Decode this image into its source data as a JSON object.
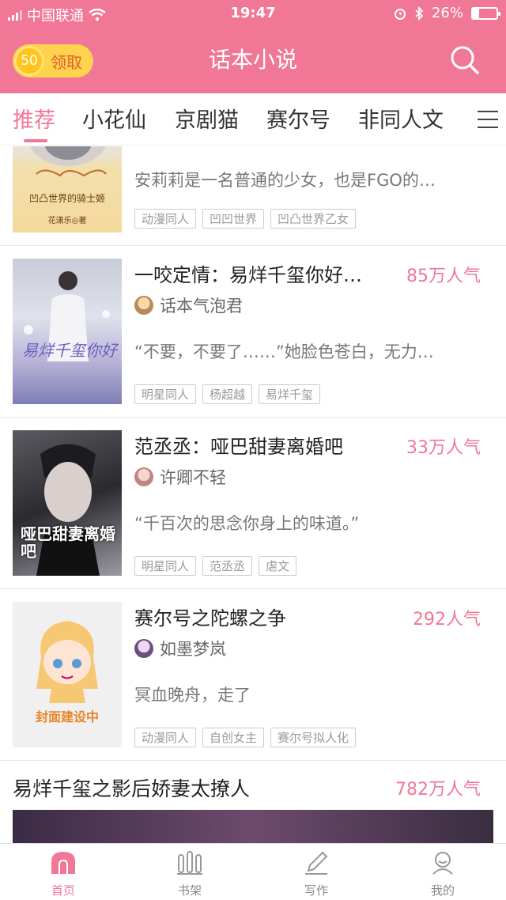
{
  "status_bar": {
    "carrier": "中国联通",
    "time": "19:47",
    "battery": "26%"
  },
  "header": {
    "coin_amount": "50",
    "claim_label": "领取",
    "title": "话本小说"
  },
  "tabs": [
    "推荐",
    "小花仙",
    "京剧猫",
    "赛尔号",
    "非同人文"
  ],
  "active_tab": 0,
  "books": [
    {
      "description": "安莉莉是一名普通的少女，也是FGO的…",
      "tags": [
        "动漫同人",
        "凹凹世界",
        "凹凸世界乙女"
      ],
      "cover_text": "凹凸世界的骑士姬",
      "cover_byline": "花潇乐◎著"
    },
    {
      "title": "一咬定情：易烊千玺你好…",
      "popularity": "85万人气",
      "author": "话本气泡君",
      "description": "“不要，不要了……”她脸色苍白，无力…",
      "tags": [
        "明星同人",
        "杨超越",
        "易烊千玺"
      ],
      "cover_text": "易烊千玺你好"
    },
    {
      "title": "范丞丞：哑巴甜妻离婚吧",
      "popularity": "33万人气",
      "author": "许卿不轻",
      "description": "“千百次的思念你身上的味道。”",
      "tags": [
        "明星同人",
        "范丞丞",
        "虐文"
      ],
      "cover_text": "哑巴甜妻离婚吧"
    },
    {
      "title": "赛尔号之陀螺之争",
      "popularity": "292人气",
      "author": "如墨梦岚",
      "description": "冥血晚舟，走了",
      "tags": [
        "动漫同人",
        "自创女主",
        "赛尔号拟人化"
      ],
      "cover_text": "封面建设中"
    },
    {
      "title": "易烊千玺之影后娇妻太撩人",
      "popularity": "782万人气"
    }
  ],
  "bottom_nav": [
    "首页",
    "书架",
    "写作",
    "我的"
  ],
  "colors": {
    "brand": "#F17797",
    "coin": "#FFD34E"
  }
}
